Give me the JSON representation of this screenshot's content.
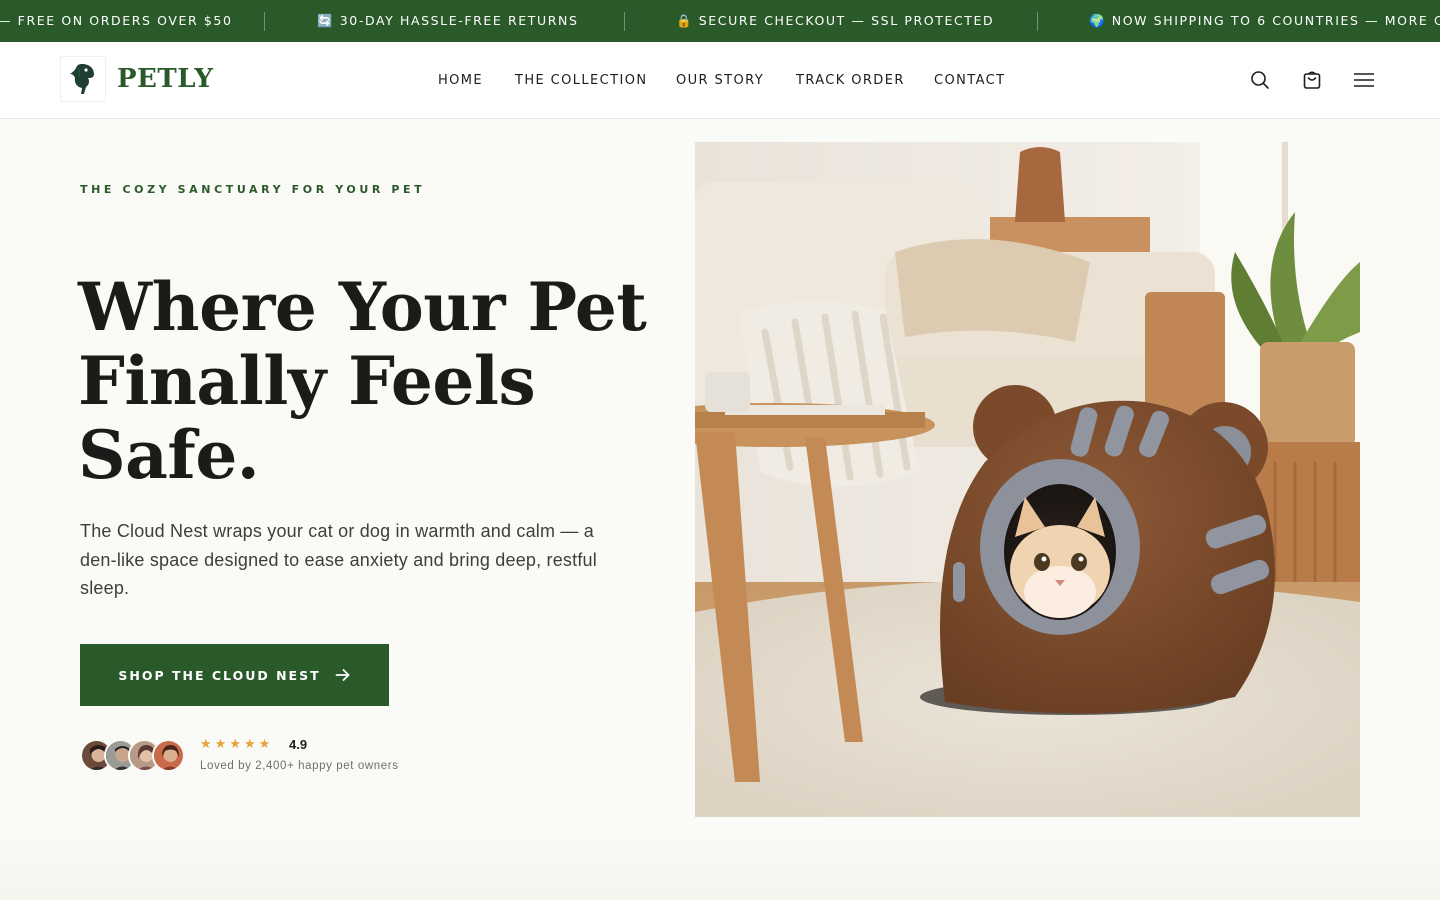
{
  "announcements": [
    {
      "text": "— FREE ON ORDERS OVER $50"
    },
    {
      "text": "🔄 30-DAY HASSLE-FREE RETURNS"
    },
    {
      "text": "🔒 SECURE CHECKOUT — SSL PROTECTED"
    },
    {
      "text": "🌍 NOW SHIPPING TO 6 COUNTRIES — MORE CO"
    }
  ],
  "brand": {
    "name": "PETLY",
    "logo_icon": "parrot-silhouette-icon",
    "color": "#2b5a2a"
  },
  "nav": {
    "items": [
      {
        "label": "HOME"
      },
      {
        "label": "THE COLLECTION"
      },
      {
        "label": "OUR STORY"
      },
      {
        "label": "TRACK ORDER"
      },
      {
        "label": "CONTACT"
      }
    ]
  },
  "header_icons": [
    "search-icon",
    "cart-icon",
    "menu-icon"
  ],
  "hero": {
    "eyebrow": "THE COZY SANCTUARY FOR YOUR PET",
    "headline_lines": [
      "Where Your Pet",
      "Finally Feels",
      "Safe."
    ],
    "subcopy": "The Cloud Nest wraps your cat or dog in warmth and calm — a den-like space designed to ease anxiety and bring deep, restful sleep.",
    "cta_label": "SHOP THE CLOUD NEST",
    "rating": "4.9",
    "stars": 5,
    "social_proof": "Loved by 2,400+ happy pet owners",
    "image_subject": "cat peeking out of a brown bear-shaped cave pet bed on a rug in a living room"
  },
  "colors": {
    "accent": "#2b5a2a",
    "star": "#e8a23a",
    "background": "#fafaf7"
  }
}
